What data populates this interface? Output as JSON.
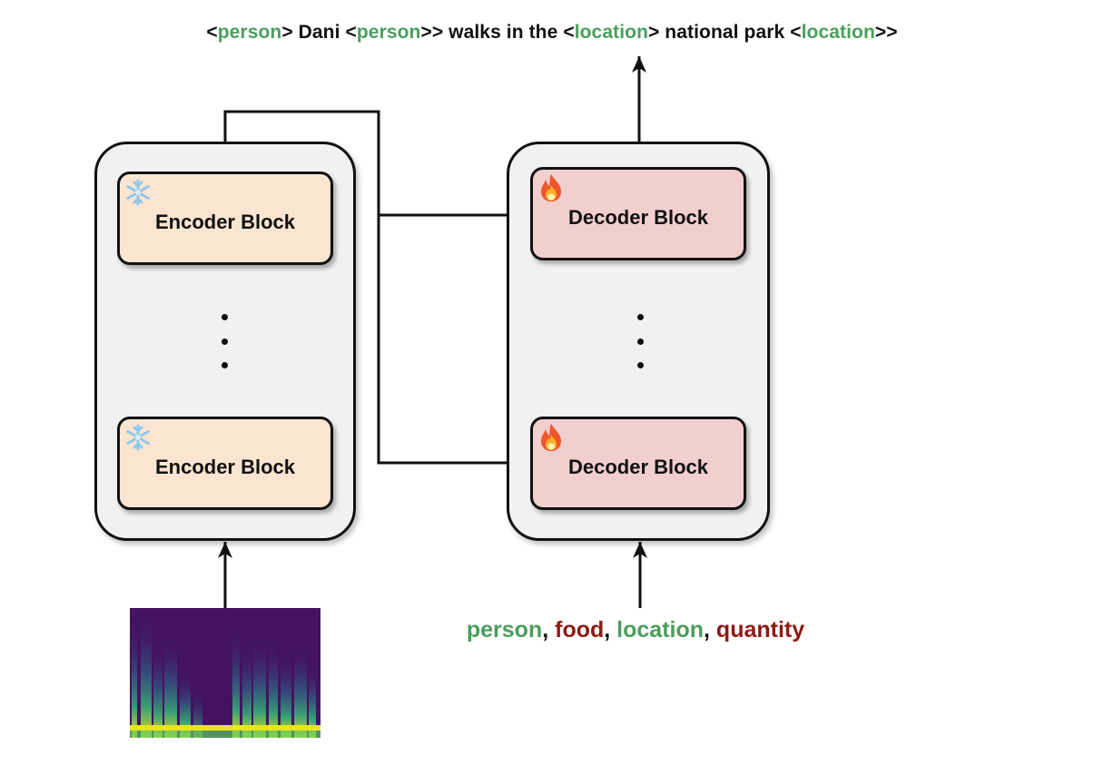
{
  "output_sequence": [
    {
      "text": "<",
      "color": "black"
    },
    {
      "text": "person",
      "color": "green"
    },
    {
      "text": "> Dani <",
      "color": "black"
    },
    {
      "text": "person",
      "color": "green"
    },
    {
      "text": ">> walks in the <",
      "color": "black"
    },
    {
      "text": "location",
      "color": "green"
    },
    {
      "text": "> national park <",
      "color": "black"
    },
    {
      "text": "location",
      "color": "green"
    },
    {
      "text": ">>",
      "color": "black"
    }
  ],
  "encoder": {
    "blocks": [
      {
        "label": "Encoder Block",
        "status_icon": "snowflake-icon",
        "state": "frozen"
      },
      {
        "label": "Encoder Block",
        "status_icon": "snowflake-icon",
        "state": "frozen"
      }
    ],
    "ellipsis": "⋮"
  },
  "decoder": {
    "blocks": [
      {
        "label": "Decoder Block",
        "status_icon": "fire-icon",
        "state": "trainable"
      },
      {
        "label": "Decoder Block",
        "status_icon": "fire-icon",
        "state": "trainable"
      }
    ],
    "ellipsis": "⋮"
  },
  "input_prompt": {
    "items": [
      {
        "text": "person",
        "color": "green"
      },
      {
        "text": ", ",
        "color": "black"
      },
      {
        "text": "food",
        "color": "red"
      },
      {
        "text": ", ",
        "color": "black"
      },
      {
        "text": "location",
        "color": "green"
      },
      {
        "text": ", ",
        "color": "black"
      },
      {
        "text": "quantity",
        "color": "red"
      }
    ]
  },
  "audio_input": {
    "type": "spectrogram",
    "icon": "spectrogram-image"
  },
  "colors": {
    "entity_green": "#4a9e5c",
    "entity_red": "#8e1a16",
    "encoder_fill": "#fbe5d0",
    "decoder_fill": "#f2cfcf",
    "stack_fill": "#f1f1f1"
  }
}
